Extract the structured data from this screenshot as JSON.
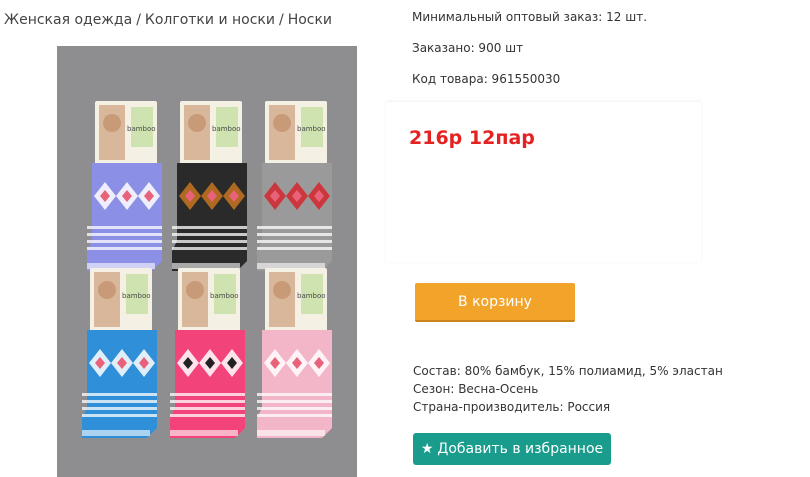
{
  "breadcrumb": {
    "items": [
      "Женская одежда",
      "Колготки и носки",
      "Носки"
    ],
    "separator": "/"
  },
  "product": {
    "image_alt_icon": "socks-photo",
    "meta": {
      "min_order": "Минимальный оптовый заказ: 12 шт.",
      "ordered": "Заказано: 900 шт",
      "sku": "Код товара: 961550030"
    },
    "price": "216р 12пар",
    "cart_button": "В корзину",
    "specs": {
      "composition": "Состав: 80% бамбук, 15% полиамид, 5% эластан",
      "season": "Сезон: Весна-Осень",
      "country": "Страна-производитель: Россия"
    },
    "favorite_button": "Добавить в избранное",
    "favorite_icon": "star-icon",
    "package_label": "bamboo"
  },
  "colors": {
    "price": "#e52222",
    "cart_button": "#f2a42a",
    "favorite_button": "#1a9c8c",
    "photo_background": "#8e8e90",
    "sock_colors": [
      "#8b90e6",
      "#2a2a2a",
      "#9a9a9a",
      "#2f8fd8",
      "#f2447a",
      "#f3b6c9"
    ]
  }
}
